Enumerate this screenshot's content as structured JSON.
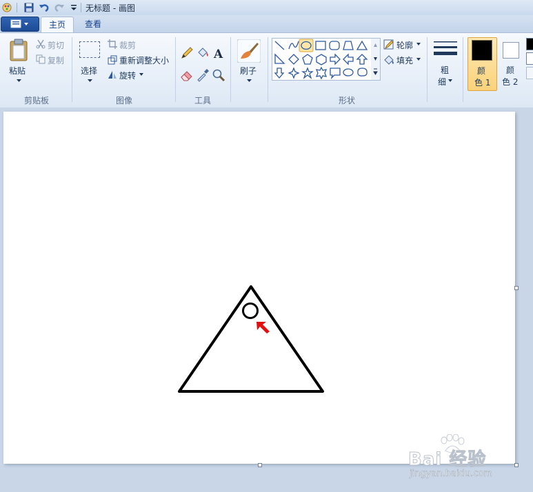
{
  "window": {
    "title": "无标题 - 画图"
  },
  "tabs": [
    {
      "label": "主页"
    },
    {
      "label": "查看"
    }
  ],
  "clipboard": {
    "paste": "粘贴",
    "cut": "剪切",
    "copy": "复制",
    "group": "剪贴板"
  },
  "image": {
    "select": "选择",
    "crop": "裁剪",
    "resize": "重新调整大小",
    "rotate": "旋转",
    "group": "图像"
  },
  "tools": {
    "group": "工具"
  },
  "brushes": {
    "label": "刷子"
  },
  "shapes": {
    "outline": "轮廓",
    "fill": "填充",
    "group": "形状"
  },
  "size": {
    "line1": "粗",
    "line2": "细"
  },
  "colors": {
    "color1_line1": "颜",
    "color1_line2": "色 1",
    "color2_line1": "颜",
    "color2_line2": "色 2",
    "color1_value": "#000000",
    "color2_value": "#ffffff"
  },
  "drawing": {
    "shape": "triangle",
    "marker": "circle",
    "stroke_color": "#000000",
    "arrow_color": "#e01010"
  },
  "watermark": {
    "brand": "Bai  经验",
    "url": "jingyan.baidu.com"
  }
}
